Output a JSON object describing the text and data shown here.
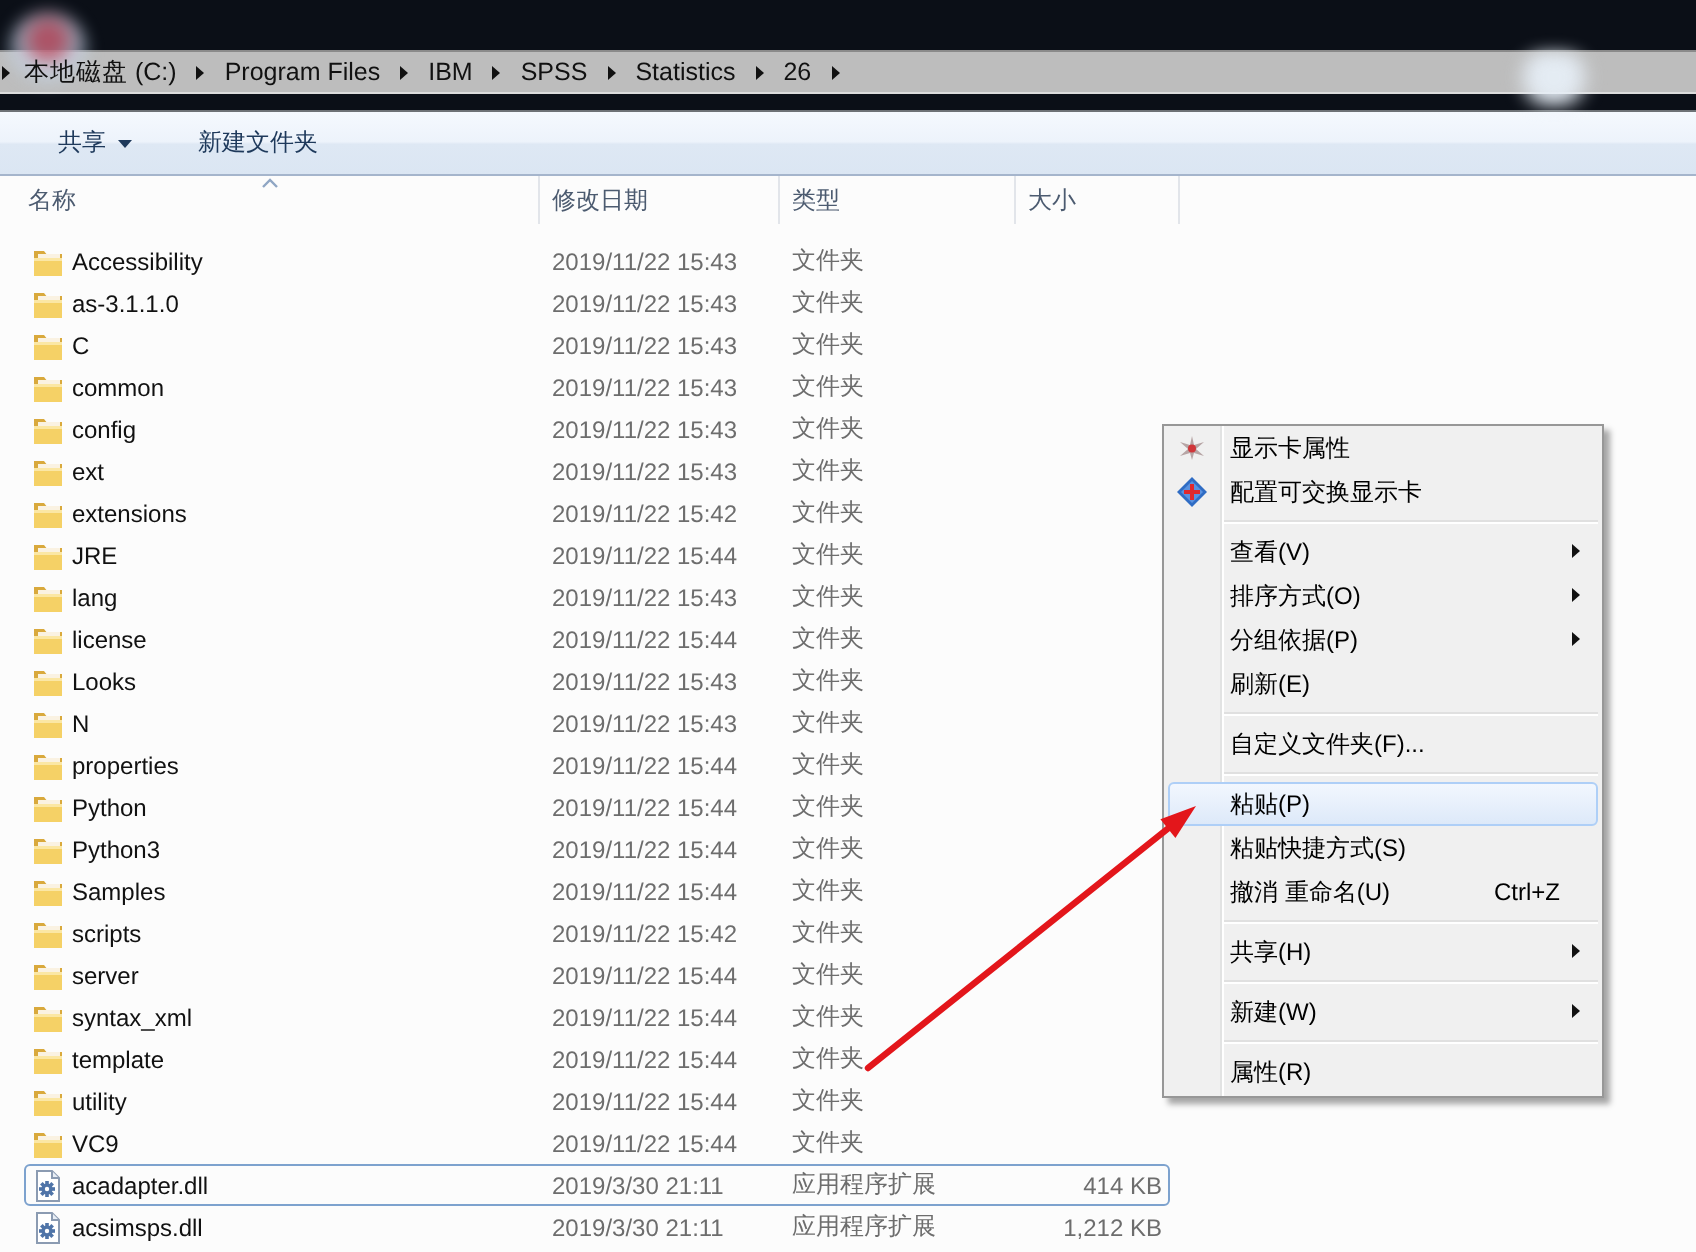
{
  "address_bar": {
    "path": [
      "本地磁盘 (C:)",
      "Program Files",
      "IBM",
      "SPSS",
      "Statistics",
      "26"
    ]
  },
  "toolbar": {
    "buttons": [
      {
        "label": "共享",
        "dropdown": true
      },
      {
        "label": "新建文件夹",
        "dropdown": false
      }
    ]
  },
  "file_list": {
    "columns": [
      {
        "label": "名称",
        "sorted": true
      },
      {
        "label": "修改日期",
        "sorted": false
      },
      {
        "label": "类型",
        "sorted": false
      },
      {
        "label": "大小",
        "sorted": false
      }
    ],
    "rows": [
      {
        "kind": "folder",
        "name": "Accessibility",
        "modified": "2019/11/22 15:43",
        "type": "文件夹",
        "focused": false
      },
      {
        "kind": "folder",
        "name": "as-3.1.1.0",
        "modified": "2019/11/22 15:43",
        "type": "文件夹",
        "focused": false
      },
      {
        "kind": "folder",
        "name": "C",
        "modified": "2019/11/22 15:43",
        "type": "文件夹",
        "focused": false
      },
      {
        "kind": "folder",
        "name": "common",
        "modified": "2019/11/22 15:43",
        "type": "文件夹",
        "focused": false
      },
      {
        "kind": "folder",
        "name": "config",
        "modified": "2019/11/22 15:43",
        "type": "文件夹",
        "focused": false
      },
      {
        "kind": "folder",
        "name": "ext",
        "modified": "2019/11/22 15:43",
        "type": "文件夹",
        "focused": false
      },
      {
        "kind": "folder",
        "name": "extensions",
        "modified": "2019/11/22 15:42",
        "type": "文件夹",
        "focused": false
      },
      {
        "kind": "folder",
        "name": "JRE",
        "modified": "2019/11/22 15:44",
        "type": "文件夹",
        "focused": false
      },
      {
        "kind": "folder",
        "name": "lang",
        "modified": "2019/11/22 15:43",
        "type": "文件夹",
        "focused": false
      },
      {
        "kind": "folder",
        "name": "license",
        "modified": "2019/11/22 15:44",
        "type": "文件夹",
        "focused": false
      },
      {
        "kind": "folder",
        "name": "Looks",
        "modified": "2019/11/22 15:43",
        "type": "文件夹",
        "focused": false
      },
      {
        "kind": "folder",
        "name": "N",
        "modified": "2019/11/22 15:43",
        "type": "文件夹",
        "focused": false
      },
      {
        "kind": "folder",
        "name": "properties",
        "modified": "2019/11/22 15:44",
        "type": "文件夹",
        "focused": false
      },
      {
        "kind": "folder",
        "name": "Python",
        "modified": "2019/11/22 15:44",
        "type": "文件夹",
        "focused": false
      },
      {
        "kind": "folder",
        "name": "Python3",
        "modified": "2019/11/22 15:44",
        "type": "文件夹",
        "focused": false
      },
      {
        "kind": "folder",
        "name": "Samples",
        "modified": "2019/11/22 15:44",
        "type": "文件夹",
        "focused": false
      },
      {
        "kind": "folder",
        "name": "scripts",
        "modified": "2019/11/22 15:42",
        "type": "文件夹",
        "focused": false
      },
      {
        "kind": "folder",
        "name": "server",
        "modified": "2019/11/22 15:44",
        "type": "文件夹",
        "focused": false
      },
      {
        "kind": "folder",
        "name": "syntax_xml",
        "modified": "2019/11/22 15:44",
        "type": "文件夹",
        "focused": false
      },
      {
        "kind": "folder",
        "name": "template",
        "modified": "2019/11/22 15:44",
        "type": "文件夹",
        "focused": false
      },
      {
        "kind": "folder",
        "name": "utility",
        "modified": "2019/11/22 15:44",
        "type": "文件夹",
        "focused": false
      },
      {
        "kind": "folder",
        "name": "VC9",
        "modified": "2019/11/22 15:44",
        "type": "文件夹",
        "focused": false
      },
      {
        "kind": "file",
        "name": "acadapter.dll",
        "modified": "2019/3/30 21:11",
        "type": "应用程序扩展",
        "size": "414 KB",
        "focused": true
      },
      {
        "kind": "file",
        "name": "acsimsps.dll",
        "modified": "2019/3/30 21:11",
        "type": "应用程序扩展",
        "size": "1,212 KB",
        "focused": false
      }
    ]
  },
  "context_menu": {
    "sections": [
      {
        "items": [
          {
            "label": "显示卡属性",
            "submenu": false,
            "selected": false
          },
          {
            "label": "配置可交换显示卡",
            "submenu": false,
            "selected": false
          }
        ]
      },
      {
        "items": [
          {
            "label": "查看(V)",
            "submenu": true,
            "selected": false
          },
          {
            "label": "排序方式(O)",
            "submenu": true,
            "selected": false
          },
          {
            "label": "分组依据(P)",
            "submenu": true,
            "selected": false
          },
          {
            "label": "刷新(E)",
            "submenu": false,
            "selected": false
          }
        ]
      },
      {
        "items": [
          {
            "label": "自定义文件夹(F)...",
            "submenu": false,
            "selected": false
          }
        ]
      },
      {
        "items": [
          {
            "label": "粘贴(P)",
            "submenu": false,
            "selected": true
          },
          {
            "label": "粘贴快捷方式(S)",
            "submenu": false,
            "selected": false
          },
          {
            "label": "撤消 重命名(U)",
            "shortcut": "Ctrl+Z",
            "submenu": false,
            "selected": false
          }
        ]
      },
      {
        "items": [
          {
            "label": "共享(H)",
            "submenu": true,
            "selected": false
          }
        ]
      },
      {
        "items": [
          {
            "label": "新建(W)",
            "submenu": true,
            "selected": false
          }
        ]
      },
      {
        "items": [
          {
            "label": "属性(R)",
            "submenu": false,
            "selected": false
          }
        ]
      }
    ]
  }
}
